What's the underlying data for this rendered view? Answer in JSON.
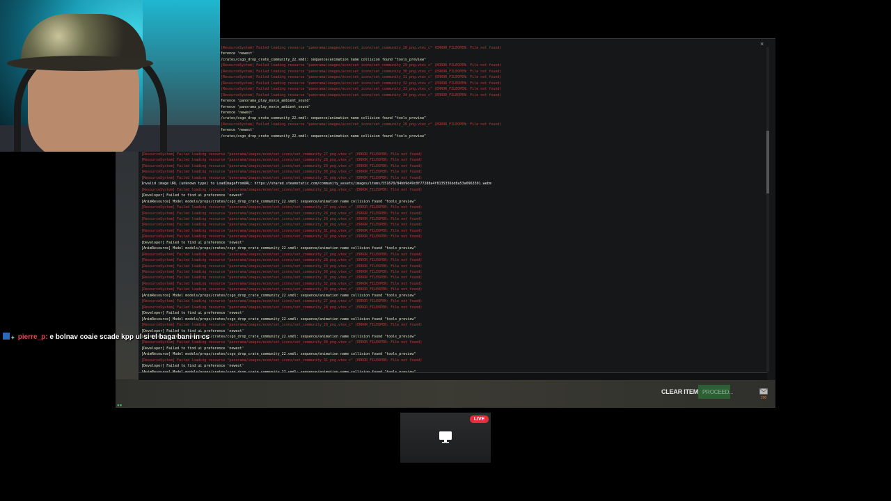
{
  "chat": {
    "username": "pierre_p:",
    "message": "e bolnav coaie scade kpp ul si el baga bani in cs"
  },
  "buttons": {
    "clear_items": "CLEAR ITEMS",
    "proceed": "PROCEED..."
  },
  "mail_badge": "200",
  "live_label": "LIVE",
  "console": {
    "close_glyph": "×",
    "lines_top": [
      {
        "t": "[ResourceSystem] Failed loading resource \"panorama/images/econ/set_icons/set_community_28_png.vtex_c\" (ERROR_FILEOPEN: File not found)",
        "c": "err"
      },
      {
        "t": "ference 'newest'",
        "c": "info"
      },
      {
        "t": "/crates/csgo_drop_crate_community_22.vmdl: sequence/animation name collision found \"tools_preview\"",
        "c": "info"
      },
      {
        "t": "[ResourceSystem] Failed loading resource \"panorama/images/econ/set_icons/set_community_29_png.vtex_c\" (ERROR_FILEOPEN: File not found)",
        "c": "err"
      },
      {
        "t": "[ResourceSystem] Failed loading resource \"panorama/images/econ/set_icons/set_community_30_png.vtex_c\" (ERROR_FILEOPEN: File not found)",
        "c": "err"
      },
      {
        "t": "[ResourceSystem] Failed loading resource \"panorama/images/econ/set_icons/set_community_31_png.vtex_c\" (ERROR_FILEOPEN: File not found)",
        "c": "err"
      },
      {
        "t": "[ResourceSystem] Failed loading resource \"panorama/images/econ/set_icons/set_community_32_png.vtex_c\" (ERROR_FILEOPEN: File not found)",
        "c": "err"
      },
      {
        "t": "[ResourceSystem] Failed loading resource \"panorama/images/econ/set_icons/set_community_33_png.vtex_c\" (ERROR_FILEOPEN: File not found)",
        "c": "err"
      },
      {
        "t": "[ResourceSystem] Failed loading resource \"panorama/images/econ/set_icons/set_community_34_png.vtex_c\" (ERROR_FILEOPEN: File not found)",
        "c": "err"
      },
      {
        "t": "ference 'panorama_play_movie_ambient_sound'",
        "c": "info"
      },
      {
        "t": "ference 'panorama_play_movie_ambient_sound'",
        "c": "info"
      },
      {
        "t": "ference 'newest'",
        "c": "info"
      },
      {
        "t": "/crates/csgo_drop_crate_community_22.vmdl: sequence/animation name collision found \"tools_preview\"",
        "c": "info"
      },
      {
        "t": "[ResourceSystem] Failed loading resource \"panorama/images/econ/set_icons/set_community_28_png.vtex_c\" (ERROR_FILEOPEN: File not found)",
        "c": "err"
      },
      {
        "t": "ference 'newest'",
        "c": "info"
      },
      {
        "t": "/crates/csgo_drop_crate_community_22.vmdl: sequence/animation name collision found \"tools_preview\"",
        "c": "info"
      }
    ],
    "lines_bottom": [
      {
        "t": "[ResourceSystem] Failed loading resource \"panorama/images/econ/set_icons/set_community_27_png.vtex_c\" (ERROR_FILEOPEN: File not found)",
        "c": "err"
      },
      {
        "t": "[ResourceSystem] Failed loading resource \"panorama/images/econ/set_icons/set_community_28_png.vtex_c\" (ERROR_FILEOPEN: File not found)",
        "c": "err"
      },
      {
        "t": "[ResourceSystem] Failed loading resource \"panorama/images/econ/set_icons/set_community_29_png.vtex_c\" (ERROR_FILEOPEN: File not found)",
        "c": "err"
      },
      {
        "t": "[ResourceSystem] Failed loading resource \"panorama/images/econ/set_icons/set_community_30_png.vtex_c\" (ERROR_FILEOPEN: File not found)",
        "c": "err"
      },
      {
        "t": "[ResourceSystem] Failed loading resource \"panorama/images/econ/set_icons/set_community_31_png.vtex_c\" (ERROR_FILEOPEN: File not found)",
        "c": "err"
      },
      {
        "t": "Invalid image URL (unknown type) to LoadImageFromURL: https://shared.steamstatic.com/community_assets/images/items/551670/84bb9d49c0f77288a4f8135336bd8a53a0963301.webm",
        "c": "white"
      },
      {
        "t": "[ResourceSystem] Failed loading resource \"panorama/images/econ/set_icons/set_community_32_png.vtex_c\" (ERROR_FILEOPEN: File not found)",
        "c": "err"
      },
      {
        "t": "[Developer] Failed to find ui preference 'newest'",
        "c": "info"
      },
      {
        "t": "[AnimResource] Model models/props/crates/csgo_drop_crate_community_22.vmdl: sequence/animation name collision found \"tools_preview\"",
        "c": "info"
      },
      {
        "t": "[ResourceSystem] Failed loading resource \"panorama/images/econ/set_icons/set_community_27_png.vtex_c\" (ERROR_FILEOPEN: File not found)",
        "c": "err"
      },
      {
        "t": "[ResourceSystem] Failed loading resource \"panorama/images/econ/set_icons/set_community_28_png.vtex_c\" (ERROR_FILEOPEN: File not found)",
        "c": "err"
      },
      {
        "t": "[ResourceSystem] Failed loading resource \"panorama/images/econ/set_icons/set_community_29_png.vtex_c\" (ERROR_FILEOPEN: File not found)",
        "c": "err"
      },
      {
        "t": "[ResourceSystem] Failed loading resource \"panorama/images/econ/set_icons/set_community_30_png.vtex_c\" (ERROR_FILEOPEN: File not found)",
        "c": "err"
      },
      {
        "t": "[ResourceSystem] Failed loading resource \"panorama/images/econ/set_icons/set_community_31_png.vtex_c\" (ERROR_FILEOPEN: File not found)",
        "c": "err"
      },
      {
        "t": "[ResourceSystem] Failed loading resource \"panorama/images/econ/set_icons/set_community_32_png.vtex_c\" (ERROR_FILEOPEN: File not found)",
        "c": "err"
      },
      {
        "t": "[Developer] Failed to find ui preference 'newest'",
        "c": "info"
      },
      {
        "t": "[AnimResource] Model models/props/crates/csgo_drop_crate_community_22.vmdl: sequence/animation name collision found \"tools_preview\"",
        "c": "info"
      },
      {
        "t": "[ResourceSystem] Failed loading resource \"panorama/images/econ/set_icons/set_community_27_png.vtex_c\" (ERROR_FILEOPEN: File not found)",
        "c": "err"
      },
      {
        "t": "[ResourceSystem] Failed loading resource \"panorama/images/econ/set_icons/set_community_28_png.vtex_c\" (ERROR_FILEOPEN: File not found)",
        "c": "err"
      },
      {
        "t": "[ResourceSystem] Failed loading resource \"panorama/images/econ/set_icons/set_community_29_png.vtex_c\" (ERROR_FILEOPEN: File not found)",
        "c": "err"
      },
      {
        "t": "[ResourceSystem] Failed loading resource \"panorama/images/econ/set_icons/set_community_30_png.vtex_c\" (ERROR_FILEOPEN: File not found)",
        "c": "err"
      },
      {
        "t": "[ResourceSystem] Failed loading resource \"panorama/images/econ/set_icons/set_community_31_png.vtex_c\" (ERROR_FILEOPEN: File not found)",
        "c": "err"
      },
      {
        "t": "[ResourceSystem] Failed loading resource \"panorama/images/econ/set_icons/set_community_32_png.vtex_c\" (ERROR_FILEOPEN: File not found)",
        "c": "err"
      },
      {
        "t": "[ResourceSystem] Failed loading resource \"panorama/images/econ/set_icons/set_community_33_png.vtex_c\" (ERROR_FILEOPEN: File not found)",
        "c": "err"
      },
      {
        "t": "[AnimResource] Model models/props/crates/csgo_drop_crate_community_22.vmdl: sequence/animation name collision found \"tools_preview\"",
        "c": "info"
      },
      {
        "t": "[ResourceSystem] Failed loading resource \"panorama/images/econ/set_icons/set_community_27_png.vtex_c\" (ERROR_FILEOPEN: File not found)",
        "c": "err"
      },
      {
        "t": "[ResourceSystem] Failed loading resource \"panorama/images/econ/set_icons/set_community_28_png.vtex_c\" (ERROR_FILEOPEN: File not found)",
        "c": "err"
      },
      {
        "t": "[Developer] Failed to find ui preference 'newest'",
        "c": "info"
      },
      {
        "t": "[AnimResource] Model models/props/crates/csgo_drop_crate_community_22.vmdl: sequence/animation name collision found \"tools_preview\"",
        "c": "info"
      },
      {
        "t": "[ResourceSystem] Failed loading resource \"panorama/images/econ/set_icons/set_community_29_png.vtex_c\" (ERROR_FILEOPEN: File not found)",
        "c": "err"
      },
      {
        "t": "[Developer] Failed to find ui preference 'newest'",
        "c": "info"
      },
      {
        "t": "[AnimResource] Model models/props/crates/csgo_drop_crate_community_22.vmdl: sequence/animation name collision found \"tools_preview\"",
        "c": "info"
      },
      {
        "t": "[ResourceSystem] Failed loading resource \"panorama/images/econ/set_icons/set_community_30_png.vtex_c\" (ERROR_FILEOPEN: File not found)",
        "c": "err"
      },
      {
        "t": "[Developer] Failed to find ui preference 'newest'",
        "c": "info"
      },
      {
        "t": "[AnimResource] Model models/props/crates/csgo_drop_crate_community_22.vmdl: sequence/animation name collision found \"tools_preview\"",
        "c": "info"
      },
      {
        "t": "[ResourceSystem] Failed loading resource \"panorama/images/econ/set_icons/set_community_31_png.vtex_c\" (ERROR_FILEOPEN: File not found)",
        "c": "err"
      },
      {
        "t": "[Developer] Failed to find ui preference 'newest'",
        "c": "info"
      },
      {
        "t": "[AnimResource] Model models/props/crates/csgo_drop_crate_community_22.vmdl: sequence/animation name collision found \"tools_preview\"",
        "c": "info"
      },
      {
        "t": "[ResourceSystem] Failed loading resource \"panorama/images/econ/set_icons/set_community_32_png.vtex_c\" (ERROR_FILEOPEN: File not found)",
        "c": "err"
      }
    ]
  },
  "colors": {
    "console_error": "#c23a3a",
    "console_info": "#e6e6cc",
    "proceed_bg": "#2d5f35",
    "live_red": "#e32d3a",
    "chat_user": "#e0474c"
  }
}
